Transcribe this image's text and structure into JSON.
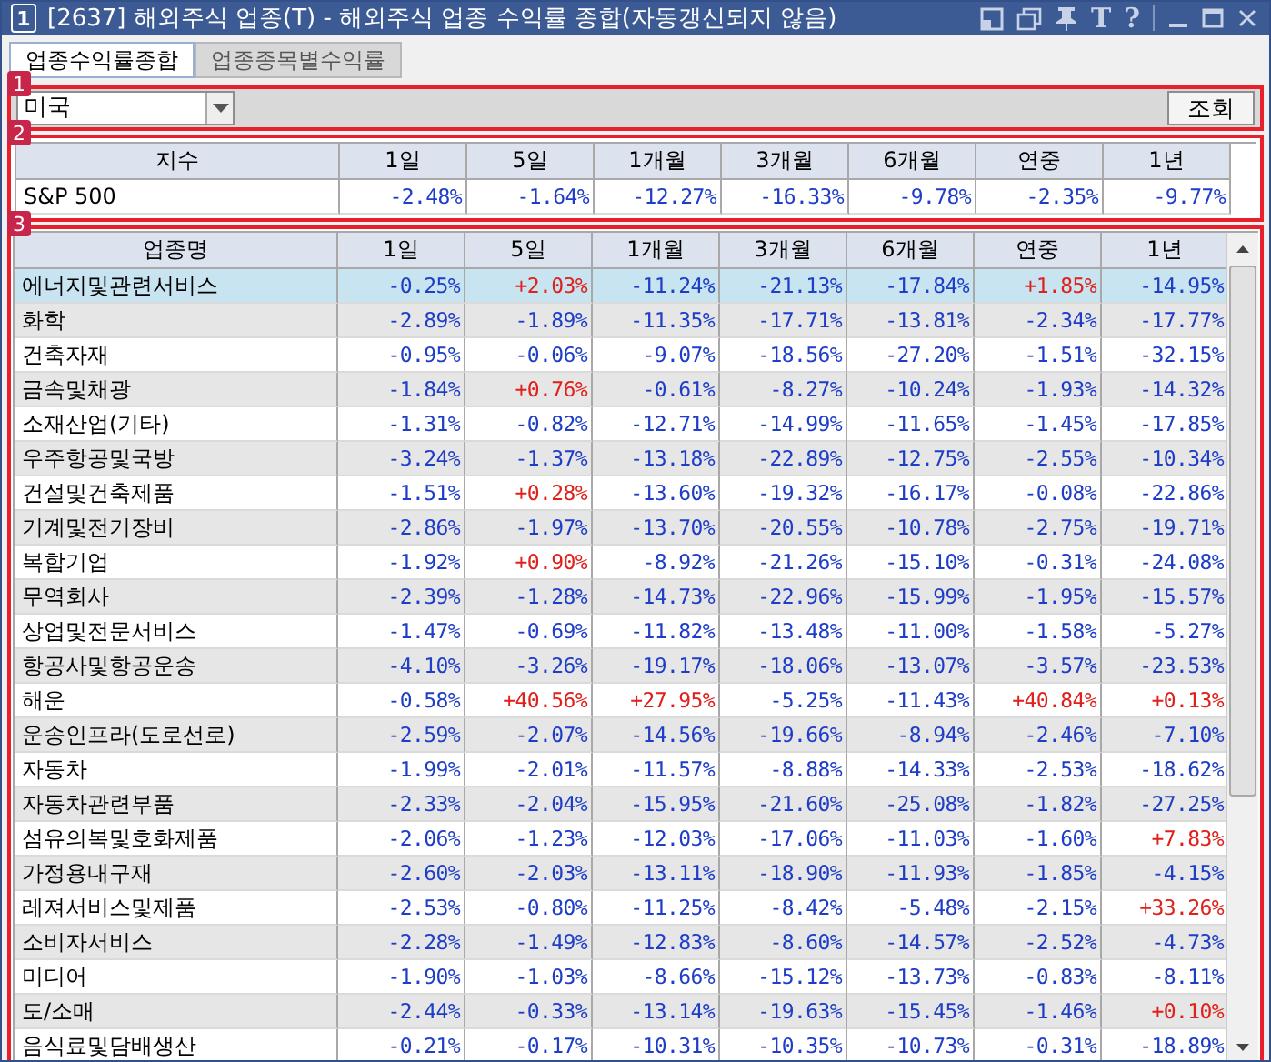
{
  "window": {
    "number": "1",
    "title": "[2637] 해외주식 업종(T) - 해외주식 업종 수익률 종합(자동갱신되지 않음)",
    "tool_texts": [
      "T",
      "?"
    ]
  },
  "tabs": [
    {
      "label": "업종수익률종합",
      "selected": true
    },
    {
      "label": "업종종목별수익률",
      "selected": false
    }
  ],
  "section_1": {
    "badge": "1",
    "market": "미국",
    "button": "조회"
  },
  "section_2": {
    "badge": "2",
    "columns": [
      "지수",
      "1일",
      "5일",
      "1개월",
      "3개월",
      "6개월",
      "연중",
      "1년"
    ],
    "rows": [
      {
        "cells": [
          {
            "v": "S&P 500"
          },
          {
            "v": "-2.48%",
            "up": false
          },
          {
            "v": "-1.64%",
            "up": false
          },
          {
            "v": "-12.27%",
            "up": false
          },
          {
            "v": "-16.33%",
            "up": false
          },
          {
            "v": "-9.78%",
            "up": false
          },
          {
            "v": "-2.35%",
            "up": false
          },
          {
            "v": "-9.77%",
            "up": false
          }
        ]
      }
    ]
  },
  "section_3": {
    "badge": "3",
    "columns": [
      "업종명",
      "1일",
      "5일",
      "1개월",
      "3개월",
      "6개월",
      "연중",
      "1년"
    ],
    "rows": [
      {
        "selected": true,
        "cells": [
          {
            "v": "에너지및관련서비스"
          },
          {
            "v": "-0.25%",
            "up": false
          },
          {
            "v": "+2.03%",
            "up": true
          },
          {
            "v": "-11.24%",
            "up": false
          },
          {
            "v": "-21.13%",
            "up": false
          },
          {
            "v": "-17.84%",
            "up": false
          },
          {
            "v": "+1.85%",
            "up": true
          },
          {
            "v": "-14.95%",
            "up": false
          }
        ]
      },
      {
        "selected": false,
        "cells": [
          {
            "v": "화학"
          },
          {
            "v": "-2.89%",
            "up": false
          },
          {
            "v": "-1.89%",
            "up": false
          },
          {
            "v": "-11.35%",
            "up": false
          },
          {
            "v": "-17.71%",
            "up": false
          },
          {
            "v": "-13.81%",
            "up": false
          },
          {
            "v": "-2.34%",
            "up": false
          },
          {
            "v": "-17.77%",
            "up": false
          }
        ]
      },
      {
        "selected": false,
        "cells": [
          {
            "v": "건축자재"
          },
          {
            "v": "-0.95%",
            "up": false
          },
          {
            "v": "-0.06%",
            "up": false
          },
          {
            "v": "-9.07%",
            "up": false
          },
          {
            "v": "-18.56%",
            "up": false
          },
          {
            "v": "-27.20%",
            "up": false
          },
          {
            "v": "-1.51%",
            "up": false
          },
          {
            "v": "-32.15%",
            "up": false
          }
        ]
      },
      {
        "selected": false,
        "cells": [
          {
            "v": "금속및채광"
          },
          {
            "v": "-1.84%",
            "up": false
          },
          {
            "v": "+0.76%",
            "up": true
          },
          {
            "v": "-0.61%",
            "up": false
          },
          {
            "v": "-8.27%",
            "up": false
          },
          {
            "v": "-10.24%",
            "up": false
          },
          {
            "v": "-1.93%",
            "up": false
          },
          {
            "v": "-14.32%",
            "up": false
          }
        ]
      },
      {
        "selected": false,
        "cells": [
          {
            "v": "소재산업(기타)"
          },
          {
            "v": "-1.31%",
            "up": false
          },
          {
            "v": "-0.82%",
            "up": false
          },
          {
            "v": "-12.71%",
            "up": false
          },
          {
            "v": "-14.99%",
            "up": false
          },
          {
            "v": "-11.65%",
            "up": false
          },
          {
            "v": "-1.45%",
            "up": false
          },
          {
            "v": "-17.85%",
            "up": false
          }
        ]
      },
      {
        "selected": false,
        "cells": [
          {
            "v": "우주항공및국방"
          },
          {
            "v": "-3.24%",
            "up": false
          },
          {
            "v": "-1.37%",
            "up": false
          },
          {
            "v": "-13.18%",
            "up": false
          },
          {
            "v": "-22.89%",
            "up": false
          },
          {
            "v": "-12.75%",
            "up": false
          },
          {
            "v": "-2.55%",
            "up": false
          },
          {
            "v": "-10.34%",
            "up": false
          }
        ]
      },
      {
        "selected": false,
        "cells": [
          {
            "v": "건설및건축제품"
          },
          {
            "v": "-1.51%",
            "up": false
          },
          {
            "v": "+0.28%",
            "up": true
          },
          {
            "v": "-13.60%",
            "up": false
          },
          {
            "v": "-19.32%",
            "up": false
          },
          {
            "v": "-16.17%",
            "up": false
          },
          {
            "v": "-0.08%",
            "up": false
          },
          {
            "v": "-22.86%",
            "up": false
          }
        ]
      },
      {
        "selected": false,
        "cells": [
          {
            "v": "기계및전기장비"
          },
          {
            "v": "-2.86%",
            "up": false
          },
          {
            "v": "-1.97%",
            "up": false
          },
          {
            "v": "-13.70%",
            "up": false
          },
          {
            "v": "-20.55%",
            "up": false
          },
          {
            "v": "-10.78%",
            "up": false
          },
          {
            "v": "-2.75%",
            "up": false
          },
          {
            "v": "-19.71%",
            "up": false
          }
        ]
      },
      {
        "selected": false,
        "cells": [
          {
            "v": "복합기업"
          },
          {
            "v": "-1.92%",
            "up": false
          },
          {
            "v": "+0.90%",
            "up": true
          },
          {
            "v": "-8.92%",
            "up": false
          },
          {
            "v": "-21.26%",
            "up": false
          },
          {
            "v": "-15.10%",
            "up": false
          },
          {
            "v": "-0.31%",
            "up": false
          },
          {
            "v": "-24.08%",
            "up": false
          }
        ]
      },
      {
        "selected": false,
        "cells": [
          {
            "v": "무역회사"
          },
          {
            "v": "-2.39%",
            "up": false
          },
          {
            "v": "-1.28%",
            "up": false
          },
          {
            "v": "-14.73%",
            "up": false
          },
          {
            "v": "-22.96%",
            "up": false
          },
          {
            "v": "-15.99%",
            "up": false
          },
          {
            "v": "-1.95%",
            "up": false
          },
          {
            "v": "-15.57%",
            "up": false
          }
        ]
      },
      {
        "selected": false,
        "cells": [
          {
            "v": "상업및전문서비스"
          },
          {
            "v": "-1.47%",
            "up": false
          },
          {
            "v": "-0.69%",
            "up": false
          },
          {
            "v": "-11.82%",
            "up": false
          },
          {
            "v": "-13.48%",
            "up": false
          },
          {
            "v": "-11.00%",
            "up": false
          },
          {
            "v": "-1.58%",
            "up": false
          },
          {
            "v": "-5.27%",
            "up": false
          }
        ]
      },
      {
        "selected": false,
        "cells": [
          {
            "v": "항공사및항공운송"
          },
          {
            "v": "-4.10%",
            "up": false
          },
          {
            "v": "-3.26%",
            "up": false
          },
          {
            "v": "-19.17%",
            "up": false
          },
          {
            "v": "-18.06%",
            "up": false
          },
          {
            "v": "-13.07%",
            "up": false
          },
          {
            "v": "-3.57%",
            "up": false
          },
          {
            "v": "-23.53%",
            "up": false
          }
        ]
      },
      {
        "selected": false,
        "cells": [
          {
            "v": "해운"
          },
          {
            "v": "-0.58%",
            "up": false
          },
          {
            "v": "+40.56%",
            "up": true
          },
          {
            "v": "+27.95%",
            "up": true
          },
          {
            "v": "-5.25%",
            "up": false
          },
          {
            "v": "-11.43%",
            "up": false
          },
          {
            "v": "+40.84%",
            "up": true
          },
          {
            "v": "+0.13%",
            "up": true
          }
        ]
      },
      {
        "selected": false,
        "cells": [
          {
            "v": "운송인프라(도로선로)"
          },
          {
            "v": "-2.59%",
            "up": false
          },
          {
            "v": "-2.07%",
            "up": false
          },
          {
            "v": "-14.56%",
            "up": false
          },
          {
            "v": "-19.66%",
            "up": false
          },
          {
            "v": "-8.94%",
            "up": false
          },
          {
            "v": "-2.46%",
            "up": false
          },
          {
            "v": "-7.10%",
            "up": false
          }
        ]
      },
      {
        "selected": false,
        "cells": [
          {
            "v": "자동차"
          },
          {
            "v": "-1.99%",
            "up": false
          },
          {
            "v": "-2.01%",
            "up": false
          },
          {
            "v": "-11.57%",
            "up": false
          },
          {
            "v": "-8.88%",
            "up": false
          },
          {
            "v": "-14.33%",
            "up": false
          },
          {
            "v": "-2.53%",
            "up": false
          },
          {
            "v": "-18.62%",
            "up": false
          }
        ]
      },
      {
        "selected": false,
        "cells": [
          {
            "v": "자동차관련부품"
          },
          {
            "v": "-2.33%",
            "up": false
          },
          {
            "v": "-2.04%",
            "up": false
          },
          {
            "v": "-15.95%",
            "up": false
          },
          {
            "v": "-21.60%",
            "up": false
          },
          {
            "v": "-25.08%",
            "up": false
          },
          {
            "v": "-1.82%",
            "up": false
          },
          {
            "v": "-27.25%",
            "up": false
          }
        ]
      },
      {
        "selected": false,
        "cells": [
          {
            "v": "섬유의복및호화제품"
          },
          {
            "v": "-2.06%",
            "up": false
          },
          {
            "v": "-1.23%",
            "up": false
          },
          {
            "v": "-12.03%",
            "up": false
          },
          {
            "v": "-17.06%",
            "up": false
          },
          {
            "v": "-11.03%",
            "up": false
          },
          {
            "v": "-1.60%",
            "up": false
          },
          {
            "v": "+7.83%",
            "up": true
          }
        ]
      },
      {
        "selected": false,
        "cells": [
          {
            "v": "가정용내구재"
          },
          {
            "v": "-2.60%",
            "up": false
          },
          {
            "v": "-2.03%",
            "up": false
          },
          {
            "v": "-13.11%",
            "up": false
          },
          {
            "v": "-18.90%",
            "up": false
          },
          {
            "v": "-11.93%",
            "up": false
          },
          {
            "v": "-1.85%",
            "up": false
          },
          {
            "v": "-4.15%",
            "up": false
          }
        ]
      },
      {
        "selected": false,
        "cells": [
          {
            "v": "레져서비스및제품"
          },
          {
            "v": "-2.53%",
            "up": false
          },
          {
            "v": "-0.80%",
            "up": false
          },
          {
            "v": "-11.25%",
            "up": false
          },
          {
            "v": "-8.42%",
            "up": false
          },
          {
            "v": "-5.48%",
            "up": false
          },
          {
            "v": "-2.15%",
            "up": false
          },
          {
            "v": "+33.26%",
            "up": true
          }
        ]
      },
      {
        "selected": false,
        "cells": [
          {
            "v": "소비자서비스"
          },
          {
            "v": "-2.28%",
            "up": false
          },
          {
            "v": "-1.49%",
            "up": false
          },
          {
            "v": "-12.83%",
            "up": false
          },
          {
            "v": "-8.60%",
            "up": false
          },
          {
            "v": "-14.57%",
            "up": false
          },
          {
            "v": "-2.52%",
            "up": false
          },
          {
            "v": "-4.73%",
            "up": false
          }
        ]
      },
      {
        "selected": false,
        "cells": [
          {
            "v": "미디어"
          },
          {
            "v": "-1.90%",
            "up": false
          },
          {
            "v": "-1.03%",
            "up": false
          },
          {
            "v": "-8.66%",
            "up": false
          },
          {
            "v": "-15.12%",
            "up": false
          },
          {
            "v": "-13.73%",
            "up": false
          },
          {
            "v": "-0.83%",
            "up": false
          },
          {
            "v": "-8.11%",
            "up": false
          }
        ]
      },
      {
        "selected": false,
        "cells": [
          {
            "v": "도/소매"
          },
          {
            "v": "-2.44%",
            "up": false
          },
          {
            "v": "-0.33%",
            "up": false
          },
          {
            "v": "-13.14%",
            "up": false
          },
          {
            "v": "-19.63%",
            "up": false
          },
          {
            "v": "-15.45%",
            "up": false
          },
          {
            "v": "-1.46%",
            "up": false
          },
          {
            "v": "+0.10%",
            "up": true
          }
        ]
      },
      {
        "selected": false,
        "cells": [
          {
            "v": "음식료및담배생산"
          },
          {
            "v": "-0.21%",
            "up": false
          },
          {
            "v": "-0.17%",
            "up": false
          },
          {
            "v": "-10.31%",
            "up": false
          },
          {
            "v": "-10.35%",
            "up": false
          },
          {
            "v": "-10.73%",
            "up": false
          },
          {
            "v": "-0.31%",
            "up": false
          },
          {
            "v": "-18.89%",
            "up": false
          }
        ]
      }
    ]
  }
}
